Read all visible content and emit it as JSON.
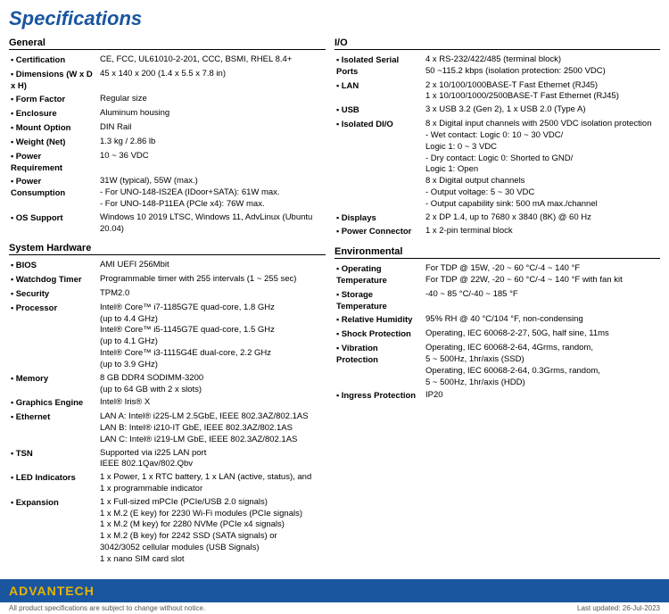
{
  "page": {
    "title": "Specifications"
  },
  "left": {
    "general": {
      "section": "General",
      "rows": [
        {
          "label": "Certification",
          "value": "CE, FCC, UL61010-2-201, CCC, BSMI, RHEL 8.4+"
        },
        {
          "label": "Dimensions (W x D x H)",
          "value": "45 x 140 x 200 (1.4 x 5.5 x 7.8 in)"
        },
        {
          "label": "Form Factor",
          "value": "Regular size"
        },
        {
          "label": "Enclosure",
          "value": "Aluminum housing"
        },
        {
          "label": "Mount Option",
          "value": "DIN Rail"
        },
        {
          "label": "Weight (Net)",
          "value": "1.3 kg / 2.86 lb"
        },
        {
          "label": "Power Requirement",
          "value": "10 ~ 36 VDC"
        },
        {
          "label": "Power Consumption",
          "value": "31W (typical), 55W (max.)\n- For UNO-148-IS2EA (IDoor+SATA): 61W max.\n- For UNO-148-P11EA (PCle x4): 76W max."
        },
        {
          "label": "OS Support",
          "value": "Windows 10 2019 LTSC, Windows 11, AdvLinux (Ubuntu 20.04)"
        }
      ]
    },
    "system_hardware": {
      "section": "System Hardware",
      "rows": [
        {
          "label": "BIOS",
          "value": "AMI UEFI 256Mbit"
        },
        {
          "label": "Watchdog Timer",
          "value": "Programmable timer with 255 intervals (1 ~ 255 sec)"
        },
        {
          "label": "Security",
          "value": "TPM2.0"
        },
        {
          "label": "Processor",
          "value": "Intel® Core™ i7-1185G7E quad-core, 1.8 GHz\n(up to 4.4 GHz)\nIntel® Core™ i5-1145G7E quad-core, 1.5 GHz\n(up to 4.1 GHz)\nIntel® Core™ i3-1115G4E dual-core, 2.2 GHz\n(up to 3.9 GHz)"
        },
        {
          "label": "Memory",
          "value": "8 GB DDR4 SODIMM-3200\n(up to 64 GB with 2 x slots)"
        },
        {
          "label": "Graphics Engine",
          "value": "Intel® Iris® X"
        },
        {
          "label": "Ethernet",
          "value": "LAN A: Intel® i225-LM 2.5GbE, IEEE 802.3AZ/802.1AS\nLAN B: Intel® i210-IT GbE, IEEE 802.3AZ/802.1AS\nLAN C: Intel® i219-LM GbE, IEEE 802.3AZ/802.1AS"
        },
        {
          "label": "TSN",
          "value": "Supported via i225 LAN port\nIEEE 802.1Qav/802.Qbv"
        },
        {
          "label": "LED Indicators",
          "value": "1 x Power, 1 x RTC battery, 1 x LAN (active, status), and\n1 x programmable indicator"
        },
        {
          "label": "Expansion",
          "value": "1 x Full-sized mPCIe (PCIe/USB 2.0 signals)\n1 x M.2 (E key) for 2230 Wi-Fi modules (PCIe signals)\n1 x M.2 (M key) for 2280 NVMe (PCIe x4 signals)\n1 x M.2 (B key) for 2242 SSD (SATA signals) or\n3042/3052 cellular modules (USB Signals)\n1 x nano SIM card slot"
        }
      ]
    }
  },
  "right": {
    "io": {
      "section": "I/O",
      "rows": [
        {
          "label": "Isolated Serial Ports",
          "value": "4 x RS-232/422/485 (terminal block)\n50 ~115.2 kbps (isolation protection: 2500 VDC)"
        },
        {
          "label": "LAN",
          "value": "2 x 10/100/1000BASE-T Fast Ethernet (RJ45)\n1 x 10/100/1000/2500BASE-T Fast Ethernet (RJ45)"
        },
        {
          "label": "USB",
          "value": "3 x USB 3.2 (Gen 2), 1 x USB 2.0 (Type A)"
        },
        {
          "label": "Isolated DI/O",
          "value": "8 x Digital input channels with 2500 VDC isolation protection\n- Wet contact: Logic 0: 10 ~ 30 VDC/\n  Logic 1: 0 ~ 3 VDC\n- Dry contact: Logic 0: Shorted to GND/\n  Logic 1: Open\n8 x Digital output channels\n- Output voltage: 5 ~ 30 VDC\n- Output capability sink: 500 mA max./channel"
        },
        {
          "label": "Displays",
          "value": "2 x DP 1.4, up to 7680 x 3840 (8K) @ 60 Hz"
        },
        {
          "label": "Power Connector",
          "value": "1 x 2-pin terminal block"
        }
      ]
    },
    "environmental": {
      "section": "Environmental",
      "rows": [
        {
          "label": "Operating Temperature",
          "value": "For TDP @ 15W, -20 ~ 60 °C/-4 ~ 140 °F\nFor TDP @ 22W, -20 ~ 60 °C/-4 ~ 140 °F with fan kit"
        },
        {
          "label": "Storage Temperature",
          "value": "-40 ~ 85 °C/-40 ~ 185 °F"
        },
        {
          "label": "Relative Humidity",
          "value": "95% RH @ 40 °C/104 °F, non-condensing"
        },
        {
          "label": "Shock Protection",
          "value": "Operating, IEC 60068-2-27, 50G, half sine, 11ms"
        },
        {
          "label": "Vibration Protection",
          "value": "Operating, IEC 60068-2-64, 4Grms, random,\n5 ~ 500Hz, 1hr/axis (SSD)\nOperating, IEC 60068-2-64, 0.3Grms, random,\n5 ~ 500Hz, 1hr/axis (HDD)"
        },
        {
          "label": "Ingress Protection",
          "value": "IP20"
        }
      ]
    }
  },
  "footer": {
    "logo_prefix": "AD",
    "logo_main": "VANTECH",
    "note_left": "All product specifications are subject to change without notice.",
    "note_right": "Last updated: 26-Jul-2023"
  }
}
